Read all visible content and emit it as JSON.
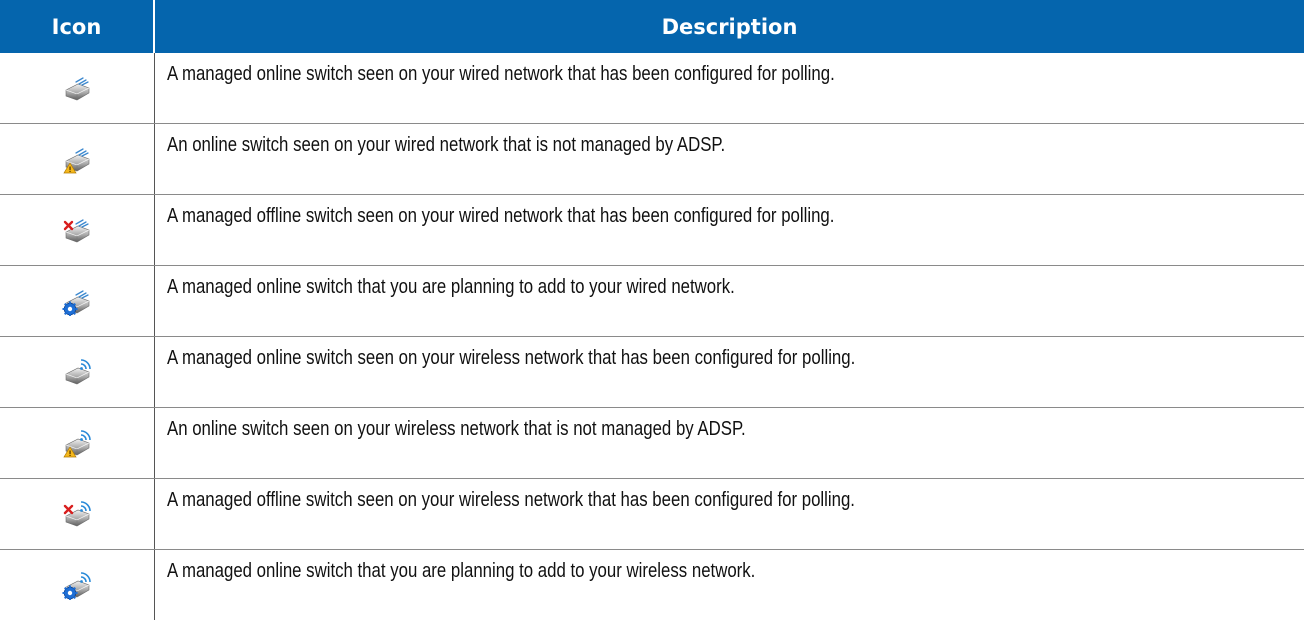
{
  "table": {
    "headers": {
      "icon": "Icon",
      "description": "Description"
    },
    "rows": [
      {
        "icon": "wired-switch-managed-online-icon",
        "description": "A managed online switch seen on your wired network that has been configured for polling."
      },
      {
        "icon": "wired-switch-unmanaged-warning-icon",
        "description": "An online switch seen on your wired network that is not managed by ADSP."
      },
      {
        "icon": "wired-switch-offline-icon",
        "description": "A managed offline switch seen on your wired network that has been configured for polling."
      },
      {
        "icon": "wired-switch-planned-icon",
        "description": "A managed online switch that you are planning to add to your wired network."
      },
      {
        "icon": "wireless-switch-managed-online-icon",
        "description": "A managed online switch seen on your wireless network that has been configured for polling."
      },
      {
        "icon": "wireless-switch-unmanaged-warning-icon",
        "description": "An online switch seen on your wireless network that is not managed by ADSP."
      },
      {
        "icon": "wireless-switch-offline-icon",
        "description": "A managed offline switch seen on your wireless network that has been configured for polling."
      },
      {
        "icon": "wireless-switch-planned-icon",
        "description": "A managed online switch that you are planning to add to your wireless network."
      }
    ]
  },
  "colors": {
    "header_bg": "#0565ad",
    "header_text": "#ffffff",
    "warning": "#f5b81c",
    "offline": "#d81e1e",
    "planned": "#1e6fd6",
    "wireless_signal": "#2a8ad8"
  }
}
